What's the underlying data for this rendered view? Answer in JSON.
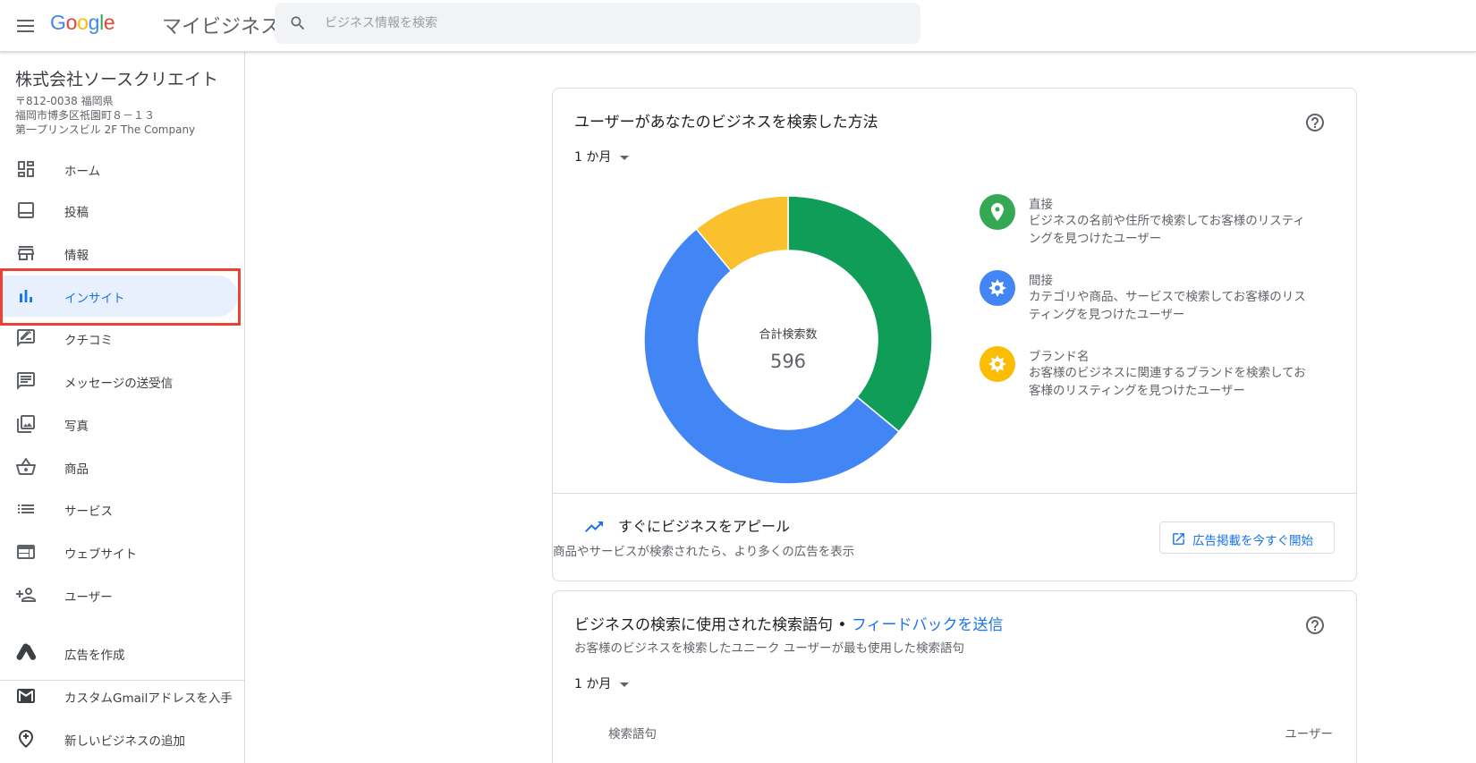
{
  "header": {
    "logo": "Google",
    "product": "マイビジネス",
    "search_placeholder": "ビジネス情報を検索"
  },
  "business": {
    "name": "株式会社ソースクリエイト",
    "address_line1": "〒812-0038 福岡県",
    "address_line2": "福岡市博多区祇園町８－１３",
    "address_line3": "第一プリンスビル 2F The Company"
  },
  "sidebar": {
    "items": [
      {
        "label": "ホーム",
        "icon": "dashboard-icon"
      },
      {
        "label": "投稿",
        "icon": "posts-icon"
      },
      {
        "label": "情報",
        "icon": "storefront-icon"
      },
      {
        "label": "インサイト",
        "icon": "bar-chart-icon",
        "active": true
      },
      {
        "label": "クチコミ",
        "icon": "rate-review-icon"
      },
      {
        "label": "メッセージの送受信",
        "icon": "chat-icon"
      },
      {
        "label": "写真",
        "icon": "photo-library-icon"
      },
      {
        "label": "商品",
        "icon": "shopping-basket-icon"
      },
      {
        "label": "サービス",
        "icon": "list-icon"
      },
      {
        "label": "ウェブサイト",
        "icon": "web-icon"
      },
      {
        "label": "ユーザー",
        "icon": "person-add-icon"
      }
    ],
    "secondary": [
      {
        "label": "広告を作成",
        "icon": "google-ads-icon"
      },
      {
        "label": "カスタムGmailアドレスを入手",
        "icon": "gmail-icon"
      },
      {
        "label": "新しいビジネスの追加",
        "icon": "add-location-icon"
      }
    ]
  },
  "search_card": {
    "title": "ユーザーがあなたのビジネスを検索した方法",
    "period": "1 か月",
    "center_label": "合計検索数",
    "total": "596",
    "legend": [
      {
        "title": "直接",
        "desc": "ビジネスの名前や住所で検索してお客様のリスティングを見つけたユーザー",
        "color": "#34a853"
      },
      {
        "title": "間接",
        "desc": "カテゴリや商品、サービスで検索してお客様のリスティングを見つけたユーザー",
        "color": "#4285f4"
      },
      {
        "title": "ブランド名",
        "desc": "お客様のビジネスに関連するブランドを検索してお客様のリスティングを見つけたユーザー",
        "color": "#fbbc04"
      }
    ],
    "promo_title": "すぐにビジネスをアピール",
    "promo_desc": "商品やサービスが検索されたら、より多くの広告を表示",
    "promo_button": "広告掲載を今すぐ開始"
  },
  "chart_data": {
    "type": "pie",
    "labels": [
      "直接",
      "間接",
      "ブランド名"
    ],
    "values": [
      36,
      53,
      11
    ],
    "colors": [
      "#0f9d58",
      "#4285f4",
      "#fbc02d"
    ]
  },
  "terms_card": {
    "title": "ビジネスの検索に使用された検索語句",
    "separator": " • ",
    "feedback_link": "フィードバックを送信",
    "subtitle": "お客様のビジネスを検索したユニーク ユーザーが最も使用した検索語句",
    "period": "1 か月",
    "col_term": "検索語句",
    "col_users": "ユーザー"
  }
}
